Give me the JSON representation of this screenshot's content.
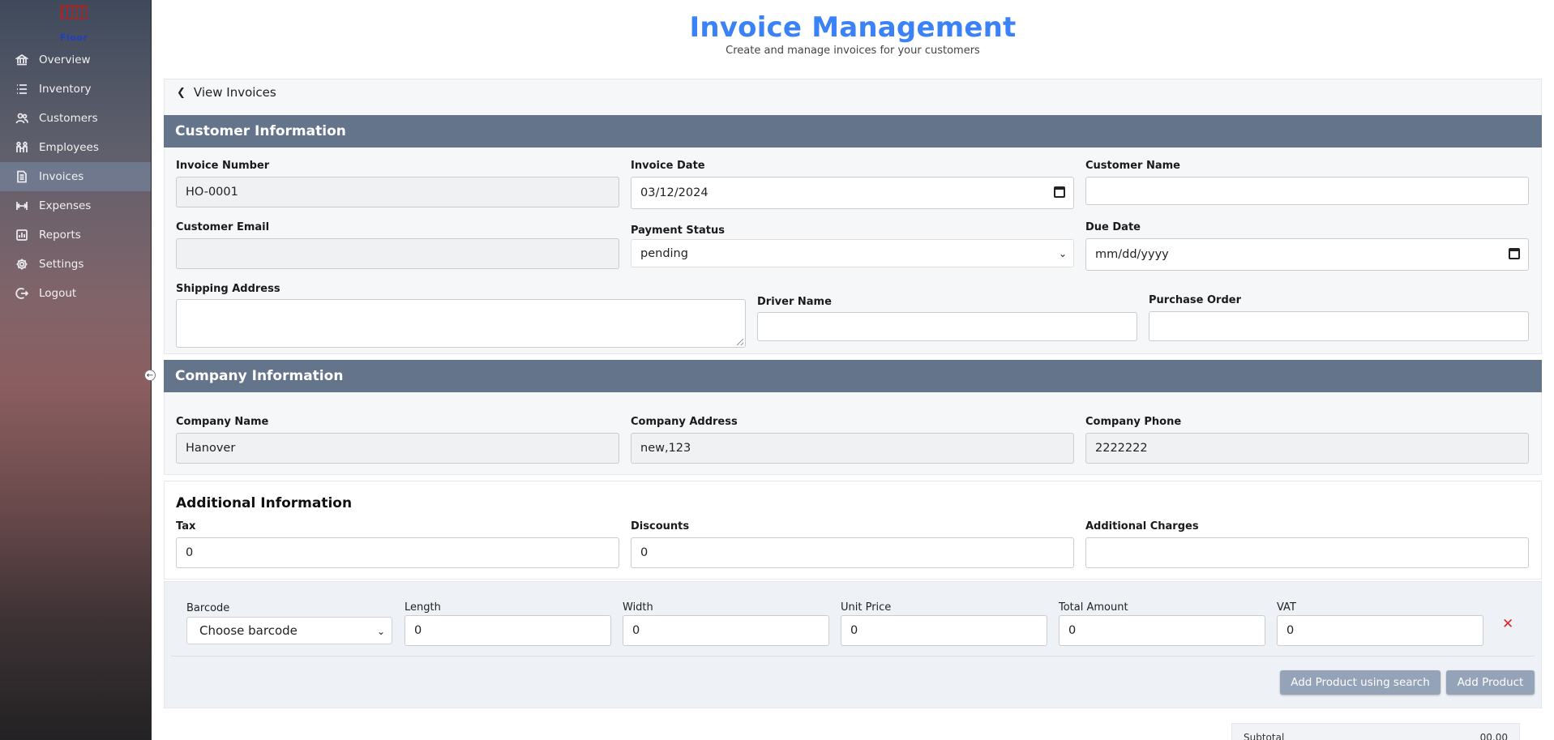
{
  "sidebar": {
    "logo_text": "Floor",
    "items": [
      {
        "label": "Overview",
        "icon": "bank-icon"
      },
      {
        "label": "Inventory",
        "icon": "list-icon"
      },
      {
        "label": "Customers",
        "icon": "users-icon"
      },
      {
        "label": "Employees",
        "icon": "employees-icon"
      },
      {
        "label": "Invoices",
        "icon": "invoice-icon",
        "active": true
      },
      {
        "label": "Expenses",
        "icon": "expenses-icon"
      },
      {
        "label": "Reports",
        "icon": "reports-icon"
      },
      {
        "label": "Settings",
        "icon": "gear-icon"
      },
      {
        "label": "Logout",
        "icon": "logout-icon"
      }
    ]
  },
  "header": {
    "title": "Invoice Management",
    "subtitle": "Create and manage invoices for your customers"
  },
  "back_link": "View Invoices",
  "customer_section": {
    "title": "Customer Information",
    "invoice_number": {
      "label": "Invoice Number",
      "value": "HO-0001"
    },
    "invoice_date": {
      "label": "Invoice Date",
      "value": "03/12/2024"
    },
    "customer_name": {
      "label": "Customer Name",
      "value": ""
    },
    "customer_email": {
      "label": "Customer Email",
      "value": ""
    },
    "payment_status": {
      "label": "Payment Status",
      "value": "pending"
    },
    "due_date": {
      "label": "Due Date",
      "placeholder": "mm/dd/yyyy"
    },
    "shipping_address": {
      "label": "Shipping Address",
      "value": ""
    },
    "driver_name": {
      "label": "Driver Name",
      "value": ""
    },
    "purchase_order": {
      "label": "Purchase Order",
      "value": ""
    }
  },
  "company_section": {
    "title": "Company Information",
    "company_name": {
      "label": "Company Name",
      "value": "Hanover"
    },
    "company_address": {
      "label": "Company Address",
      "value": "new,123"
    },
    "company_phone": {
      "label": "Company Phone",
      "value": "2222222"
    }
  },
  "additional_section": {
    "title": "Additional Information",
    "tax": {
      "label": "Tax",
      "value": "0"
    },
    "discounts": {
      "label": "Discounts",
      "value": "0"
    },
    "additional_charges": {
      "label": "Additional Charges",
      "value": ""
    }
  },
  "product_row": {
    "barcode": {
      "label": "Barcode",
      "value": "Choose barcode"
    },
    "length": {
      "label": "Length",
      "value": "0"
    },
    "width": {
      "label": "Width",
      "value": "0"
    },
    "unit_price": {
      "label": "Unit Price",
      "value": "0"
    },
    "total_amount": {
      "label": "Total Amount",
      "value": "0"
    },
    "vat": {
      "label": "VAT",
      "value": "0"
    },
    "remove_symbol": "✕"
  },
  "buttons": {
    "add_product_search": "Add Product using search",
    "add_product": "Add Product"
  },
  "subtotal": {
    "label": "Subtotal",
    "value": "00.00"
  }
}
